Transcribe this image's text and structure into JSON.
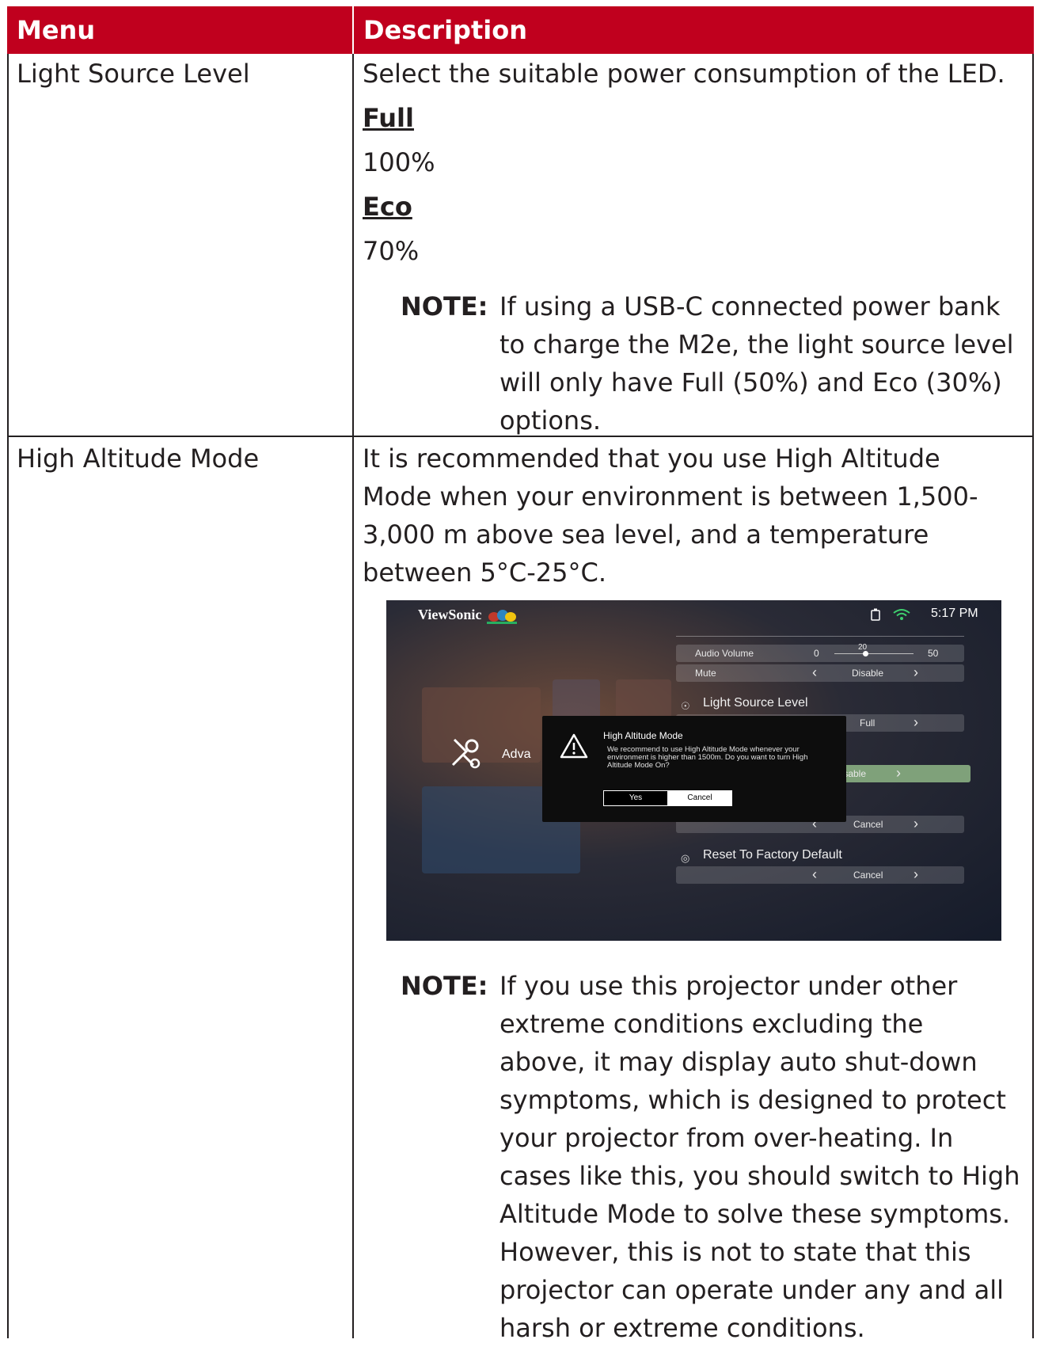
{
  "header": {
    "menu": "Menu",
    "description": "Description"
  },
  "rows": [
    {
      "menu": "Light Source Level",
      "intro": "Select the suitable power consumption of the LED.",
      "options": [
        {
          "name": "Full",
          "value": "100%"
        },
        {
          "name": "Eco",
          "value": "70%"
        }
      ],
      "note_label": "NOTE:",
      "note_lines": [
        "If using a USB-C connected power bank",
        "to charge the M2e, the light source level",
        "will only have Full (50%) and Eco (30%)",
        "options."
      ]
    },
    {
      "menu": "High Altitude Mode",
      "intro_lines": [
        "It is recommended that you use High Altitude",
        "Mode when your environment is between 1,500-",
        "3,000 m above sea level, and a temperature",
        "between 5°C-25°C."
      ],
      "note_label": "NOTE:",
      "note_lines": [
        "If you use this projector under other",
        "extreme conditions excluding the",
        "above, it may display auto shut-down",
        "symptoms, which is designed to protect",
        "your projector from over-heating. In",
        "cases like this, you should switch to High",
        "Altitude Mode to solve these symptoms.",
        "However, this is not to state that this",
        "projector can operate under any and all",
        "harsh or extreme conditions."
      ]
    }
  ],
  "screenshot": {
    "brand": "ViewSonic",
    "time": "5:17 PM",
    "icons": [
      "battery-icon",
      "wifi-icon",
      "warning-icon",
      "tools-icon",
      "bulb-icon",
      "reset-icon"
    ],
    "audio_volume": {
      "label": "Audio Volume",
      "min": "0",
      "value": "20",
      "max": "50",
      "level": 0.4
    },
    "mute": {
      "label": "Mute",
      "value": "Disable"
    },
    "light_source": {
      "label": "Light Source Level",
      "value": "Full"
    },
    "advanced_label": "Adva",
    "high_altitude_value": "Disable",
    "reset_settings_value": "Cancel",
    "reset_factory": {
      "label": "Reset To Factory Default",
      "value": "Cancel"
    },
    "dialog": {
      "title": "High Altitude Mode",
      "message": "We recommend to use High Altitude Mode whenever your environment is higher than 1500m. Do you want to turn High Altitude Mode On?",
      "yes": "Yes",
      "cancel": "Cancel"
    },
    "accent_color": "#7fa17a"
  },
  "colors": {
    "header_bg": "#c0001e",
    "header_text": "#ffffff",
    "border": "#231f20"
  }
}
